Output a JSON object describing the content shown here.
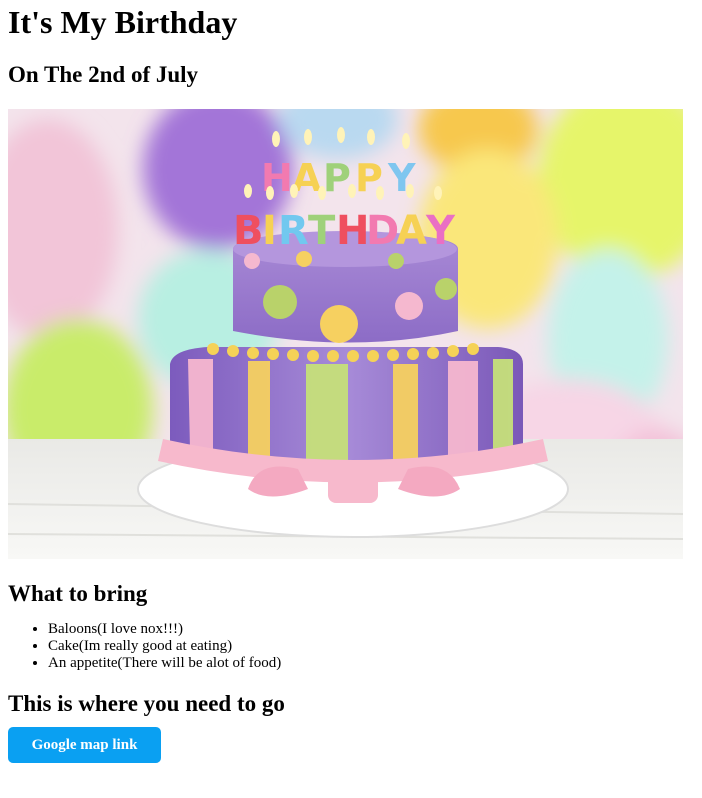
{
  "header": {
    "title": "It's My Birthday",
    "date_line": "On The 2nd of July"
  },
  "hero_image": {
    "caption_letters_top": "HAPPY",
    "caption_letters_bottom": "BIRTHDAY"
  },
  "bring": {
    "heading": "What to bring",
    "items": [
      "Baloons(I love nox!!!)",
      "Cake(Im really good at eating)",
      "An appetite(There will be alot of food)"
    ]
  },
  "location": {
    "heading": "This is where you need to go",
    "button_label": "Google map link",
    "button_color": "#0aa0f2"
  }
}
